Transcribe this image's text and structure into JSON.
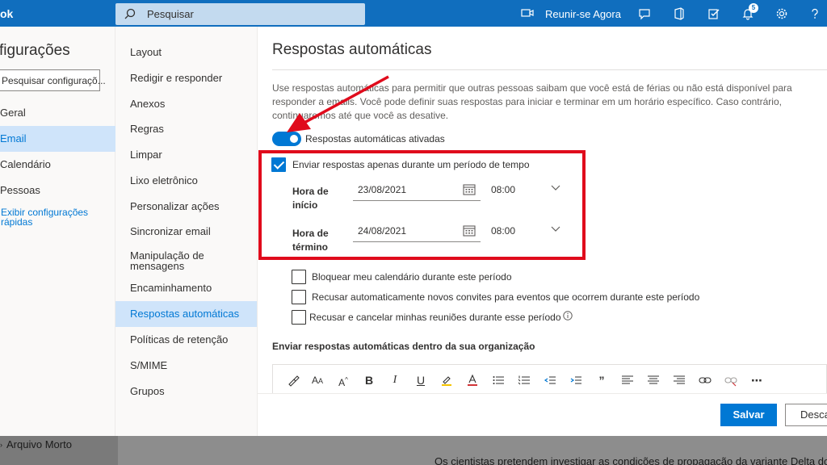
{
  "topbar": {
    "brand": "ok",
    "search_placeholder": "Pesquisar",
    "meet_label": "Reunir-se Agora",
    "notifications_count": "5"
  },
  "background": {
    "archive_label": "Arquivo Morto",
    "news_snippet": "Os cientistas pretendem investigar as condições de propagação da variante Delta do"
  },
  "settings": {
    "title": "figurações",
    "search_placeholder": "Pesquisar configuraçõ...",
    "nav": [
      {
        "label": "Geral"
      },
      {
        "label": "Email"
      },
      {
        "label": "Calendário"
      },
      {
        "label": "Pessoas"
      }
    ],
    "quick_settings_link": "Exibir configurações rápidas"
  },
  "email_nav": {
    "items": [
      "Layout",
      "Redigir e responder",
      "Anexos",
      "Regras",
      "Limpar",
      "Lixo eletrônico",
      "Personalizar ações",
      "Sincronizar email",
      "Manipulação de mensagens",
      "Encaminhamento",
      "Respostas automáticas",
      "Políticas de retenção",
      "S/MIME",
      "Grupos"
    ]
  },
  "auto_reply": {
    "title": "Respostas automáticas",
    "description": "Use respostas automáticas para permitir que outras pessoas saibam que você está de férias ou não está disponível para responder a emails. Você pode definir suas respostas para iniciar e terminar em um horário específico. Caso contrário, continuaremos até que você as desative.",
    "toggle_label": "Respostas automáticas ativadas",
    "toggle_on": true,
    "period_checkbox_label": "Enviar respostas apenas durante um período de tempo",
    "start_label": "Hora de início",
    "start_date": "23/08/2021",
    "start_time": "08:00",
    "end_label": "Hora de término",
    "end_date": "24/08/2021",
    "end_time": "08:00",
    "option_block_calendar": "Bloquear meu calendário durante este período",
    "option_decline_invites": "Recusar automaticamente novos convites para eventos que ocorrem durante este período",
    "option_cancel_meetings": "Recusar e cancelar minhas reuniões durante esse período",
    "inside_org_heading": "Enviar respostas automáticas dentro da sua organização",
    "save_label": "Salvar",
    "discard_label": "Descartar"
  },
  "colors": {
    "accent": "#0078d4",
    "topbar": "#106ebe",
    "highlight": "#e00b1c"
  }
}
